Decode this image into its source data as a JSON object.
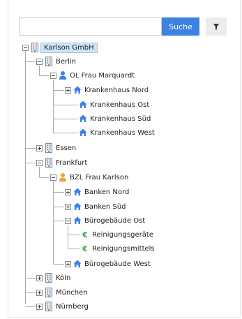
{
  "search": {
    "value": "",
    "placeholder": "",
    "button_label": "Suche"
  },
  "filter": {
    "icon": "filter-icon"
  },
  "colors": {
    "accent": "#3d82e3",
    "building": "#8a9aa6",
    "person": "#f0a234",
    "house": "#3d82e3",
    "euro": "#2faa4a",
    "selection": "#cde6f7"
  },
  "tree": {
    "root": "Karlson GmbH",
    "berlin": "Berlin",
    "ol_marquardt": "OL Frau Marquardt",
    "kh_nord": "Krankenhaus Nord",
    "kh_ost": "Krankenhaus Ost",
    "kh_sued": "Krankenhaus Süd",
    "kh_west": "Krankenhaus West",
    "essen": "Essen",
    "frankfurt": "Frankfurt",
    "bzl_karlson": "BZL Frau Karlson",
    "banken_nord": "Banken Nord",
    "banken_sued": "Banken Süd",
    "buero_ost": "Bürogebäude Ost",
    "reinigungsgeraete": "Reinigungsgeräte",
    "reinigungsmittels": "Reinigungsmittels",
    "buero_west": "Bürogebäude West",
    "koeln": "Köln",
    "muenchen": "München",
    "nuernberg": "Nürnberg"
  }
}
